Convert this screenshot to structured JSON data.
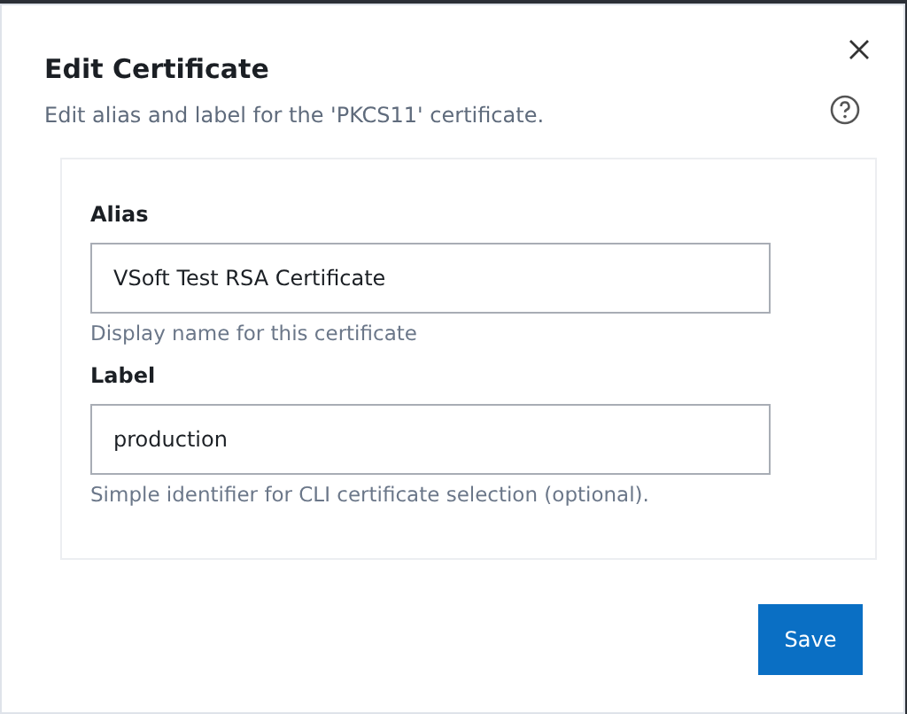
{
  "dialog": {
    "title": "Edit Certificate",
    "subtitle": "Edit alias and label for the 'PKCS11' certificate.",
    "fields": [
      {
        "label": "Alias",
        "value": "VSoft Test RSA Certificate",
        "hint": "Display name for this certificate"
      },
      {
        "label": "Label",
        "value": "production",
        "hint": "Simple identifier for CLI certificate selection (optional)."
      }
    ],
    "buttons": [
      "Save"
    ]
  }
}
